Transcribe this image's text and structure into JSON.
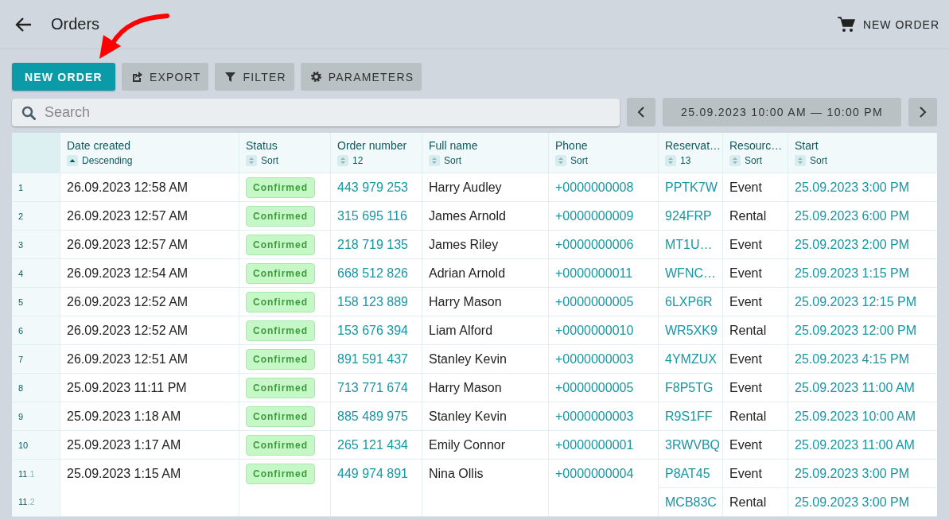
{
  "header": {
    "title": "Orders",
    "action": "NEW ORDER"
  },
  "toolbar": [
    {
      "label": "NEW ORDER",
      "kind": "primary"
    },
    {
      "label": "EXPORT",
      "kind": "export"
    },
    {
      "label": "FILTER",
      "kind": "filter"
    },
    {
      "label": "PARAMETERS",
      "kind": "parameters"
    }
  ],
  "search": {
    "placeholder": "Search"
  },
  "date_range": {
    "label": "25.09.2023 10:00 AM — 10:00 PM"
  },
  "table": {
    "columns": [
      {
        "label": "Date created",
        "sort_label": "Descending",
        "sorted": true
      },
      {
        "label": "Status",
        "sort_label": "Sort",
        "sorted": false
      },
      {
        "label": "Order number",
        "sort_label": "12",
        "sorted": false
      },
      {
        "label": "Full name",
        "sort_label": "Sort",
        "sorted": false
      },
      {
        "label": "Phone",
        "sort_label": "Sort",
        "sorted": false
      },
      {
        "label": "Reservat…",
        "sort_label": "13",
        "sorted": false
      },
      {
        "label": "Resourc…",
        "sort_label": "Sort",
        "sorted": false
      },
      {
        "label": "Start",
        "sort_label": "Sort",
        "sorted": false
      }
    ],
    "rows": [
      {
        "index": "1",
        "created": "26.09.2023 12:58 AM",
        "status": "Confirmed",
        "order": "443 979 253",
        "name": "Harry Audley",
        "phone": "+0000000008",
        "reservations": [
          {
            "code": "PPTK7W",
            "resource": "Event",
            "start": "25.09.2023 3:00 PM"
          }
        ]
      },
      {
        "index": "2",
        "created": "26.09.2023 12:57 AM",
        "status": "Confirmed",
        "order": "315 695 116",
        "name": "James Arnold",
        "phone": "+0000000009",
        "reservations": [
          {
            "code": "924FRP",
            "resource": "Rental",
            "start": "25.09.2023 6:00 PM"
          }
        ]
      },
      {
        "index": "3",
        "created": "26.09.2023 12:57 AM",
        "status": "Confirmed",
        "order": "218 719 135",
        "name": "James Riley",
        "phone": "+0000000006",
        "reservations": [
          {
            "code": "MT1U…",
            "resource": "Event",
            "start": "25.09.2023 2:00 PM"
          }
        ]
      },
      {
        "index": "4",
        "created": "26.09.2023 12:54 AM",
        "status": "Confirmed",
        "order": "668 512 826",
        "name": "Adrian Arnold",
        "phone": "+0000000011",
        "reservations": [
          {
            "code": "WFNC…",
            "resource": "Event",
            "start": "25.09.2023 1:15 PM"
          }
        ]
      },
      {
        "index": "5",
        "created": "26.09.2023 12:52 AM",
        "status": "Confirmed",
        "order": "158 123 889",
        "name": "Harry Mason",
        "phone": "+0000000005",
        "reservations": [
          {
            "code": "6LXP6R",
            "resource": "Event",
            "start": "25.09.2023 12:15 PM"
          }
        ]
      },
      {
        "index": "6",
        "created": "26.09.2023 12:52 AM",
        "status": "Confirmed",
        "order": "153 676 394",
        "name": "Liam Alford",
        "phone": "+0000000010",
        "reservations": [
          {
            "code": "WR5XK9",
            "resource": "Rental",
            "start": "25.09.2023 12:00 PM"
          }
        ]
      },
      {
        "index": "7",
        "created": "26.09.2023 12:51 AM",
        "status": "Confirmed",
        "order": "891 591 437",
        "name": "Stanley Kevin",
        "phone": "+0000000003",
        "reservations": [
          {
            "code": "4YMZUX",
            "resource": "Event",
            "start": "25.09.2023 4:15 PM"
          }
        ]
      },
      {
        "index": "8",
        "created": "25.09.2023 11:11 PM",
        "status": "Confirmed",
        "order": "713 771 674",
        "name": "Harry Mason",
        "phone": "+0000000005",
        "reservations": [
          {
            "code": "F8P5TG",
            "resource": "Event",
            "start": "25.09.2023 11:00 AM"
          }
        ]
      },
      {
        "index": "9",
        "created": "25.09.2023 1:18 AM",
        "status": "Confirmed",
        "order": "885 489 975",
        "name": "Stanley Kevin",
        "phone": "+0000000003",
        "reservations": [
          {
            "code": "R9S1FF",
            "resource": "Rental",
            "start": "25.09.2023 10:00 AM"
          }
        ]
      },
      {
        "index": "10",
        "created": "25.09.2023 1:17 AM",
        "status": "Confirmed",
        "order": "265 121 434",
        "name": "Emily Connor",
        "phone": "+0000000001",
        "reservations": [
          {
            "code": "3RWVBQ",
            "resource": "Event",
            "start": "25.09.2023 11:00 AM"
          }
        ]
      },
      {
        "created": "25.09.2023 1:15 AM",
        "status": "Confirmed",
        "order": "449 974 891",
        "name": "Nina Ollis",
        "phone": "+0000000004",
        "reservations": [
          {
            "number": "11",
            "sub": ".1",
            "code": "P8AT45",
            "resource": "Event",
            "start": "25.09.2023 3:00 PM"
          },
          {
            "number": "11",
            "sub": ".2",
            "code": "MCB83C",
            "resource": "Rental",
            "start": "25.09.2023 3:00 PM"
          }
        ]
      }
    ]
  }
}
